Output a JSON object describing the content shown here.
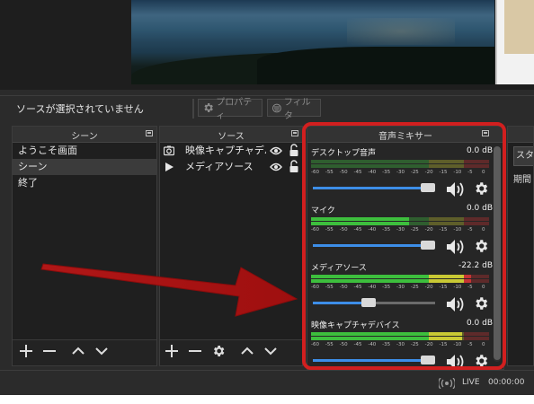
{
  "toolbar": {
    "no_source": "ソースが選択されていません",
    "properties": "プロパティ",
    "filters": "フィルタ"
  },
  "scenes": {
    "title": "シーン",
    "items": [
      "ようこそ画面",
      "シーン",
      "終了"
    ],
    "selected": "シーン"
  },
  "sources": {
    "title": "ソース",
    "items": [
      {
        "label": "映像キャプチャデバ",
        "icon": "camera-icon"
      },
      {
        "label": "メディアソース",
        "icon": "play-icon"
      }
    ]
  },
  "mixer": {
    "title": "音声ミキサー",
    "scale": [
      "-60",
      "-55",
      "-50",
      "-45",
      "-40",
      "-35",
      "-30",
      "-25",
      "-20",
      "-15",
      "-10",
      "-5",
      "0"
    ],
    "channels": [
      {
        "name": "デスクトップ音声",
        "db": "0.0 dB",
        "level": 0.0,
        "volume": 1.0
      },
      {
        "name": "マイク",
        "db": "0.0 dB",
        "level": 0.55,
        "volume": 1.0
      },
      {
        "name": "メディアソース",
        "db": "-22.2 dB",
        "level": 0.9,
        "volume": 0.45
      },
      {
        "name": "映像キャプチャデバイス",
        "db": "0.0 dB",
        "level": 0.85,
        "volume": 1.0
      }
    ]
  },
  "controls": {
    "button_fragment": "スタ",
    "label_fragment": "期間"
  },
  "status": {
    "live": "LIVE",
    "time": "00:00:00"
  },
  "colors": {
    "highlight": "#d11f1f",
    "fader": "#3d8ee8",
    "meter_green": "#3dbf3d",
    "meter_yellow": "#c9c934",
    "meter_red": "#c43434"
  }
}
